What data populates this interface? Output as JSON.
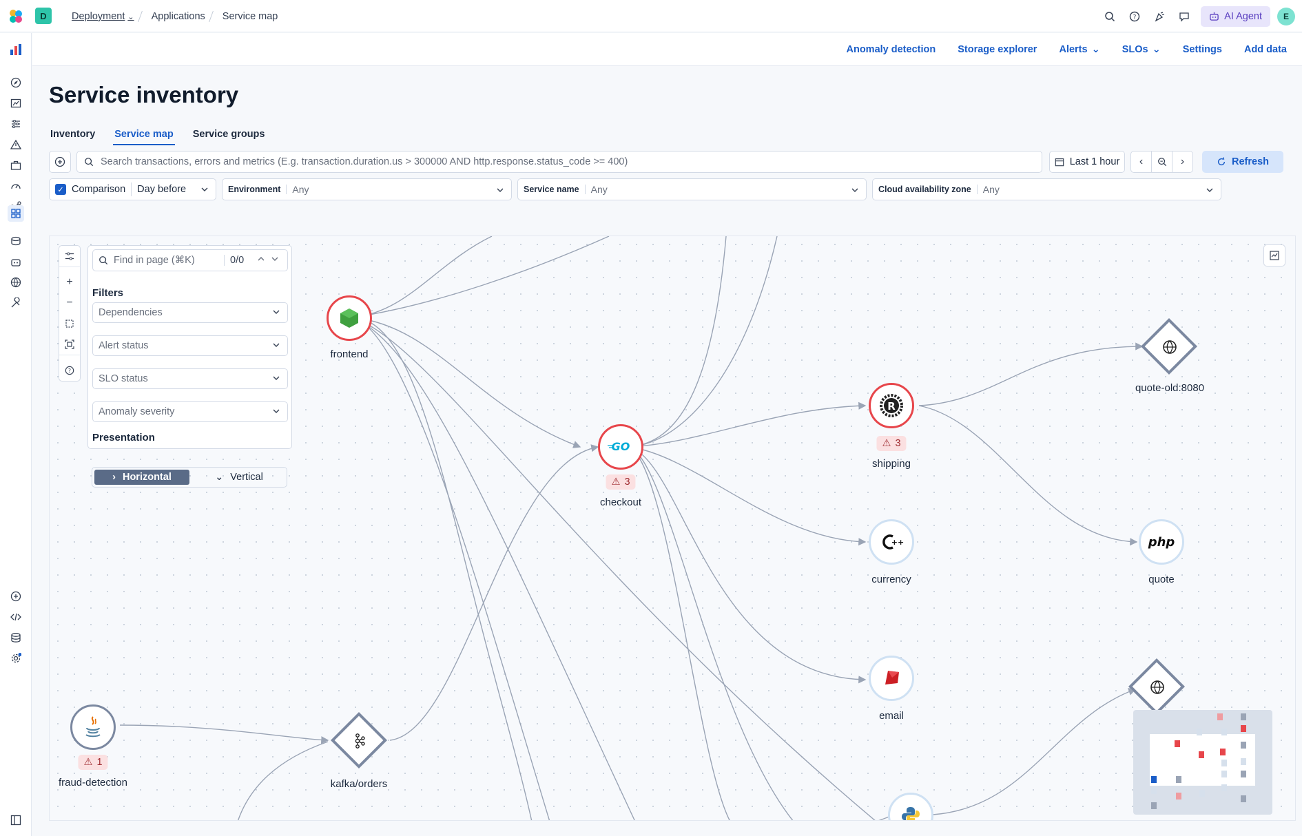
{
  "header": {
    "space_initial": "D",
    "breadcrumbs": [
      "Deployment",
      "Applications",
      "Service map"
    ],
    "ai_agent_label": "AI Agent",
    "user_initial": "E"
  },
  "app_links": {
    "anomaly": "Anomaly detection",
    "storage": "Storage explorer",
    "alerts": "Alerts",
    "slos": "SLOs",
    "settings": "Settings",
    "add_data": "Add data"
  },
  "page": {
    "title": "Service inventory",
    "tabs": [
      "Inventory",
      "Service map",
      "Service groups"
    ],
    "active_tab": "Service map"
  },
  "search": {
    "placeholder": "Search transactions, errors and metrics (E.g. transaction.duration.us > 300000 AND http.response.status_code >= 400)"
  },
  "time": {
    "range": "Last 1 hour",
    "refresh_label": "Refresh"
  },
  "filters": {
    "comparison_label": "Comparison",
    "comparison_value": "Day before",
    "environment_label": "Environment",
    "environment_value": "Any",
    "service_name_label": "Service name",
    "service_name_value": "Any",
    "cloud_zone_label": "Cloud availability zone",
    "cloud_zone_value": "Any"
  },
  "map_panel": {
    "find_placeholder": "Find in page (⌘K)",
    "find_count": "0/0",
    "filters_heading": "Filters",
    "dependencies": "Dependencies",
    "alert_status": "Alert status",
    "slo_status": "SLO status",
    "anomaly_severity": "Anomaly severity",
    "presentation_heading": "Presentation",
    "horizontal": "Horizontal",
    "vertical": "Vertical"
  },
  "nodes": {
    "frontend": {
      "label": "frontend"
    },
    "checkout": {
      "label": "checkout",
      "alerts": "3"
    },
    "shipping": {
      "label": "shipping",
      "alerts": "3"
    },
    "currency": {
      "label": "currency"
    },
    "email": {
      "label": "email"
    },
    "quote_old": {
      "label": "quote-old:8080"
    },
    "quote": {
      "label": "quote",
      "icon_text": "php"
    },
    "fraud_detection": {
      "label": "fraud-detection",
      "alerts": "1"
    },
    "kafka_orders": {
      "label": "kafka/orders"
    }
  },
  "colors": {
    "accent": "#1a5dc8",
    "alert_red": "#e7464b",
    "edge_gray": "#9aa4b5"
  }
}
